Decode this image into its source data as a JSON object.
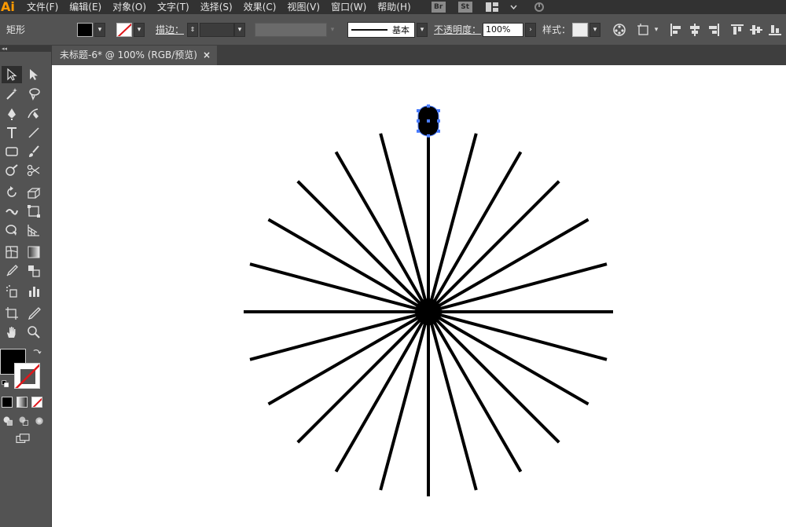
{
  "app": {
    "logo": "Ai",
    "menus": [
      "文件(F)",
      "编辑(E)",
      "对象(O)",
      "文字(T)",
      "选择(S)",
      "效果(C)",
      "视图(V)",
      "窗口(W)",
      "帮助(H)"
    ],
    "bridge_badge": "Br",
    "stock_badge": "St"
  },
  "control_bar": {
    "selection_type": "矩形",
    "stroke_label": "描边：",
    "stroke_profile": "基本",
    "opacity_label": "不透明度：",
    "opacity_value": "100%",
    "style_label": "样式："
  },
  "document": {
    "tab_title": "未标题-6* @ 100% (RGB/预览)",
    "close_glyph": "×"
  },
  "colors": {
    "accent": "#ff9a00",
    "selection": "#4a7cff",
    "ui_bg": "#535353",
    "menu_bg": "#323232"
  },
  "artwork": {
    "description_shape": "radial line burst",
    "ray_count": 24,
    "selected_object": "rounded rectangle"
  }
}
